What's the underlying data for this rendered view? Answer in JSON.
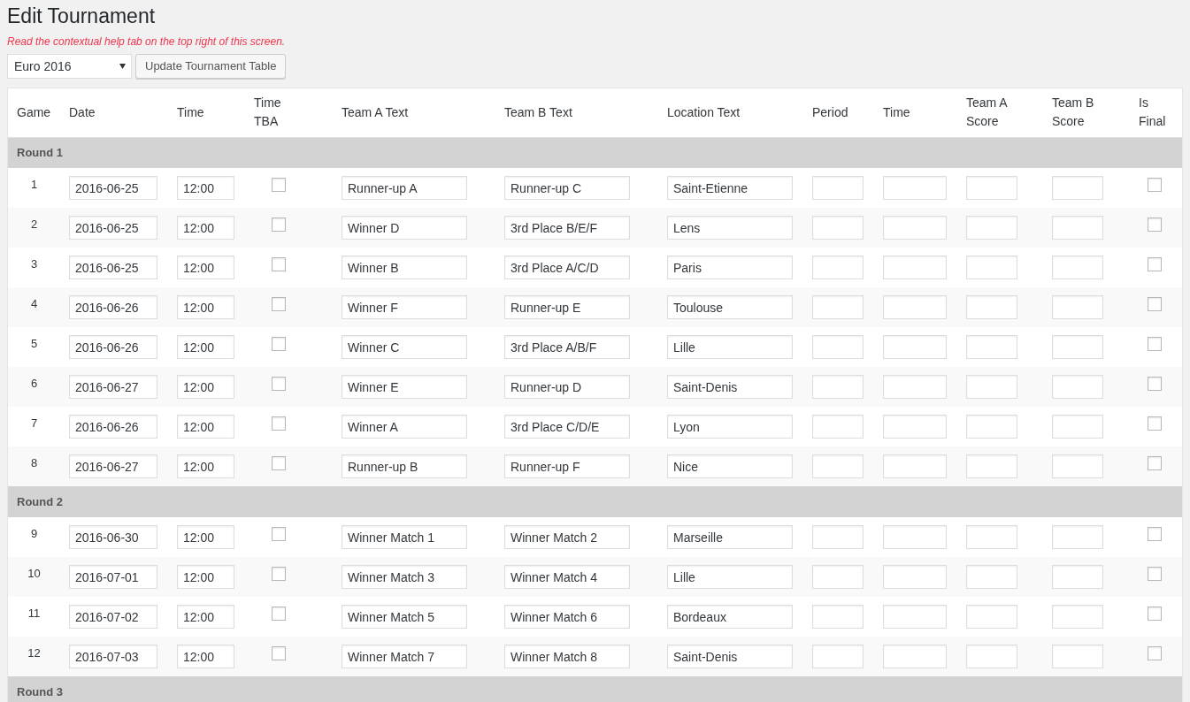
{
  "title": "Edit Tournament",
  "help_text": "Read the contextual help tab on the top right of this screen.",
  "tournament_select": {
    "value": "Euro 2016"
  },
  "update_button": "Update Tournament Table",
  "columns": [
    "Game",
    "Date",
    "Time",
    "Time\nTBA",
    "Team A Text",
    "Team B Text",
    "Location Text",
    "Period",
    "Time",
    "Team A\nScore",
    "Team B\nScore",
    "Is\nFinal"
  ],
  "rounds": [
    {
      "title": "Round 1",
      "games": [
        {
          "game": "1",
          "date": "2016-06-25",
          "time": "12:00",
          "time_tba": false,
          "team_a": "Runner-up A",
          "team_b": "Runner-up C",
          "location": "Saint-Etienne",
          "is_final": false
        },
        {
          "game": "2",
          "date": "2016-06-25",
          "time": "12:00",
          "time_tba": false,
          "team_a": "Winner D",
          "team_b": "3rd Place B/E/F",
          "location": "Lens",
          "is_final": false
        },
        {
          "game": "3",
          "date": "2016-06-25",
          "time": "12:00",
          "time_tba": false,
          "team_a": "Winner B",
          "team_b": "3rd Place A/C/D",
          "location": "Paris",
          "is_final": false
        },
        {
          "game": "4",
          "date": "2016-06-26",
          "time": "12:00",
          "time_tba": false,
          "team_a": "Winner F",
          "team_b": "Runner-up E",
          "location": "Toulouse",
          "is_final": false
        },
        {
          "game": "5",
          "date": "2016-06-26",
          "time": "12:00",
          "time_tba": false,
          "team_a": "Winner C",
          "team_b": "3rd Place A/B/F",
          "location": "Lille",
          "is_final": false
        },
        {
          "game": "6",
          "date": "2016-06-27",
          "time": "12:00",
          "time_tba": false,
          "team_a": "Winner E",
          "team_b": "Runner-up D",
          "location": "Saint-Denis",
          "is_final": false
        },
        {
          "game": "7",
          "date": "2016-06-26",
          "time": "12:00",
          "time_tba": false,
          "team_a": "Winner A",
          "team_b": "3rd Place C/D/E",
          "location": "Lyon",
          "is_final": false
        },
        {
          "game": "8",
          "date": "2016-06-27",
          "time": "12:00",
          "time_tba": false,
          "team_a": "Runner-up B",
          "team_b": "Runner-up F",
          "location": "Nice",
          "is_final": false
        }
      ]
    },
    {
      "title": "Round 2",
      "games": [
        {
          "game": "9",
          "date": "2016-06-30",
          "time": "12:00",
          "time_tba": false,
          "team_a": "Winner Match 1",
          "team_b": "Winner Match 2",
          "location": "Marseille",
          "is_final": false
        },
        {
          "game": "10",
          "date": "2016-07-01",
          "time": "12:00",
          "time_tba": false,
          "team_a": "Winner Match 3",
          "team_b": "Winner Match 4",
          "location": "Lille",
          "is_final": false
        },
        {
          "game": "11",
          "date": "2016-07-02",
          "time": "12:00",
          "time_tba": false,
          "team_a": "Winner Match 5",
          "team_b": "Winner Match 6",
          "location": "Bordeaux",
          "is_final": false
        },
        {
          "game": "12",
          "date": "2016-07-03",
          "time": "12:00",
          "time_tba": false,
          "team_a": "Winner Match 7",
          "team_b": "Winner Match 8",
          "location": "Saint-Denis",
          "is_final": false
        }
      ]
    },
    {
      "title": "Round 3"
    }
  ]
}
